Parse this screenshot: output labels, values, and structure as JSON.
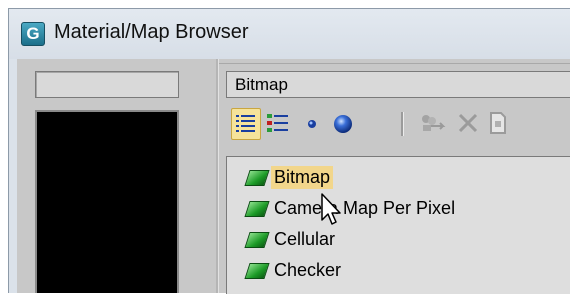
{
  "window": {
    "title": "Material/Map Browser",
    "app_icon_glyph": "G"
  },
  "name_field": {
    "value": ""
  },
  "type_field": {
    "value": "Bitmap"
  },
  "toolbar": {
    "buttons": [
      {
        "icon": "view-list-icon",
        "active": true
      },
      {
        "icon": "view-list-icons-icon",
        "active": false
      },
      {
        "icon": "view-small-icons-icon",
        "active": false
      },
      {
        "icon": "view-large-icons-icon",
        "active": false
      },
      {
        "icon": "update-scene-materials-icon",
        "active": false
      },
      {
        "icon": "delete-icon",
        "active": false
      },
      {
        "icon": "clear-library-icon",
        "active": false
      }
    ]
  },
  "list": {
    "items": [
      {
        "label": "Bitmap",
        "selected": true
      },
      {
        "label": "Camera Map Per Pixel",
        "selected": false
      },
      {
        "label": "Cellular",
        "selected": false
      },
      {
        "label": "Checker",
        "selected": false
      }
    ]
  },
  "colors": {
    "selection": "#f2d68b",
    "map_icon_green": "#1c9b27",
    "active_button": "#f6e39a"
  }
}
